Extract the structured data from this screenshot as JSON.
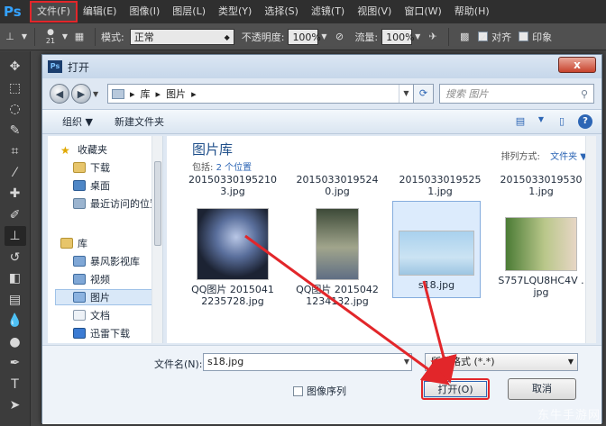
{
  "app": {
    "logo": "Ps",
    "menu": [
      "文件(F)",
      "编辑(E)",
      "图像(I)",
      "图层(L)",
      "类型(Y)",
      "选择(S)",
      "滤镜(T)",
      "视图(V)",
      "窗口(W)",
      "帮助(H)"
    ],
    "highlighted_menu": "文件(F)"
  },
  "options_bar": {
    "brush_size": "21",
    "mode_label": "模式:",
    "mode_value": "正常",
    "opacity_label": "不透明度:",
    "opacity_value": "100%",
    "flow_label": "流量:",
    "flow_value": "100%",
    "align_label": "对齐",
    "sample_label": "印象"
  },
  "dialog": {
    "title": "打开",
    "close_label": "x",
    "breadcrumb": [
      "库",
      "图片"
    ],
    "search_placeholder": "搜索 图片",
    "organize_label": "组织 ▼",
    "new_folder_label": "新建文件夹",
    "help_label": "?",
    "nav": {
      "favorites": "收藏夹",
      "downloads": "下载",
      "desktop": "桌面",
      "recent": "最近访问的位置",
      "libraries": "库",
      "storm_video": "暴风影视库",
      "videos": "视频",
      "pictures": "图片",
      "documents": "文档",
      "xunlei": "迅雷下载"
    },
    "library": {
      "title": "图片库",
      "includes_label": "包括:",
      "includes_link": "2 个位置",
      "sort_label": "排列方式:",
      "sort_value": "文件夹 ▼"
    },
    "files_top": [
      {
        "name": "20150330195210 3.jpg"
      },
      {
        "name": "20150330195240.jpg"
      },
      {
        "name": "20150330195251.jpg"
      },
      {
        "name": "20150330195301.jpg"
      }
    ],
    "files_mid": [
      {
        "name": "QQ图片 20150412235728.jpg"
      },
      {
        "name": "QQ图片 20150421234132.jpg"
      },
      {
        "name": "s18.jpg"
      },
      {
        "name": "S757LQU8HC4V .jpg"
      }
    ],
    "filename_label": "文件名(N):",
    "filename_value": "s18.jpg",
    "format_value": "所有格式 (*.*)",
    "sequence_label": "图像序列",
    "open_button": "打开(O)",
    "cancel_button": "取消"
  },
  "watermark": "东牛手游网"
}
